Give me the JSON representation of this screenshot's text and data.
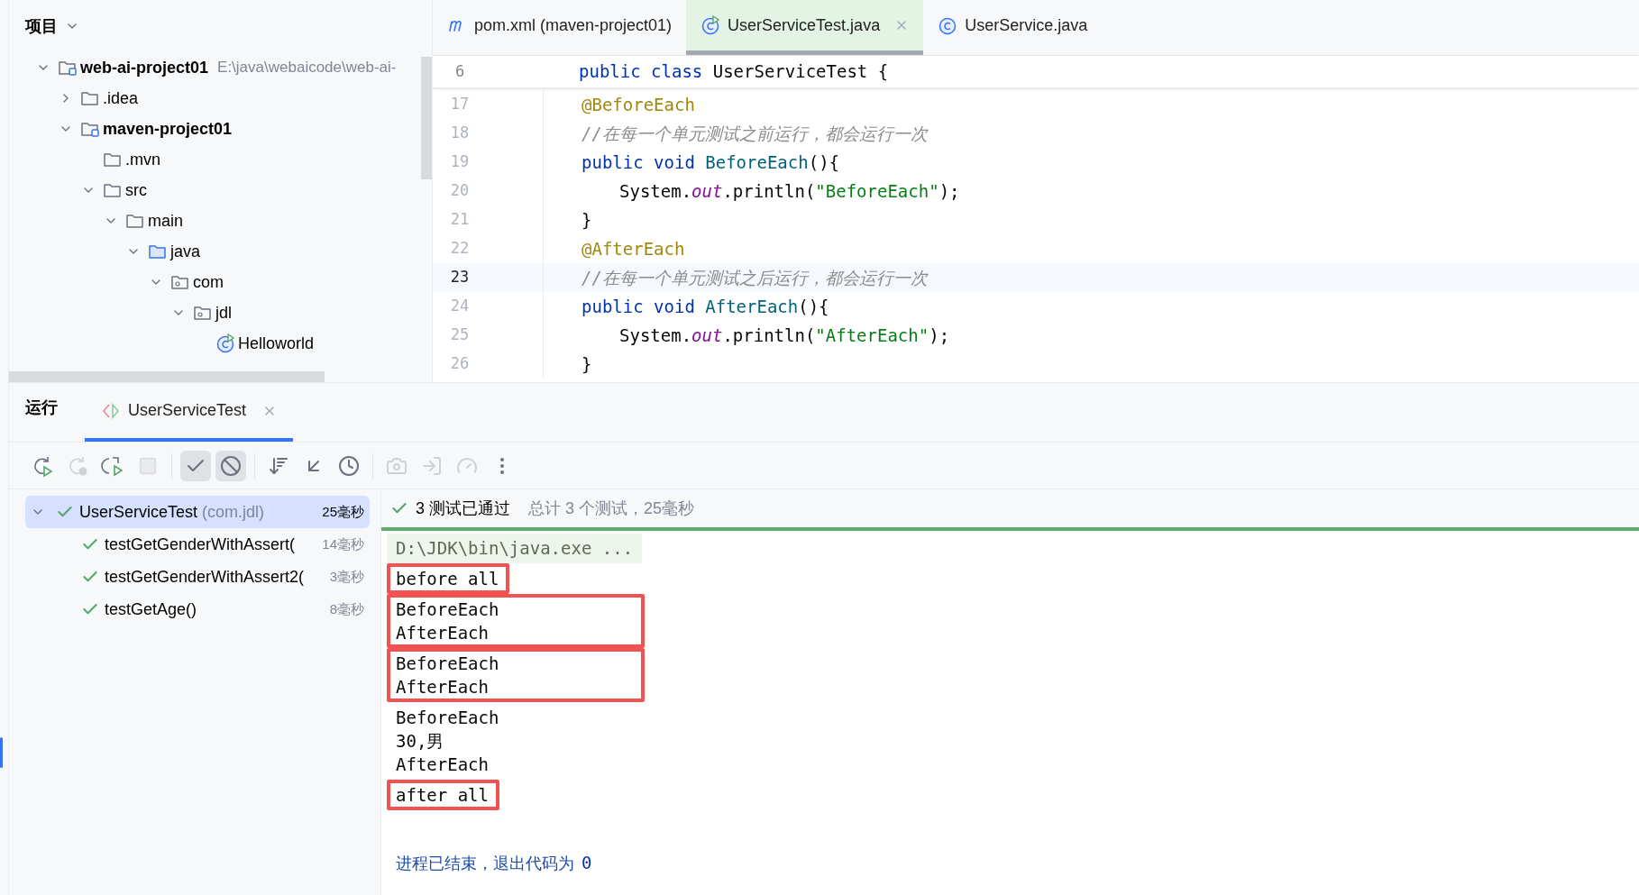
{
  "project_panel": {
    "title": "项目",
    "tree": [
      {
        "kind": "module",
        "label": "web-ai-project01",
        "path": "E:\\java\\webaicode\\web-ai-",
        "expanded": true,
        "children": [
          {
            "kind": "folder",
            "label": ".idea",
            "expanded": false
          },
          {
            "kind": "module",
            "label": "maven-project01",
            "expanded": true,
            "children": [
              {
                "kind": "folder",
                "label": ".mvn"
              },
              {
                "kind": "folder",
                "label": "src",
                "expanded": true,
                "children": [
                  {
                    "kind": "folder",
                    "label": "main",
                    "expanded": true,
                    "children": [
                      {
                        "kind": "source",
                        "label": "java",
                        "expanded": true,
                        "children": [
                          {
                            "kind": "package",
                            "label": "com",
                            "expanded": true,
                            "children": [
                              {
                                "kind": "package",
                                "label": "jdl",
                                "expanded": true,
                                "children": [
                                  {
                                    "kind": "test-class",
                                    "label": "Helloworld"
                                  }
                                ]
                              }
                            ]
                          }
                        ]
                      }
                    ]
                  }
                ]
              }
            ]
          }
        ]
      }
    ]
  },
  "editor": {
    "tabs": [
      {
        "kind": "maven",
        "label": "pom.xml (maven-project01)",
        "selected": false,
        "closable": false
      },
      {
        "kind": "test-class",
        "label": "UserServiceTest.java",
        "selected": true,
        "closable": true
      },
      {
        "kind": "class",
        "label": "UserService.java",
        "selected": false,
        "closable": false
      }
    ],
    "sticky_line": {
      "number": "6",
      "kind": "class",
      "tokens": [
        {
          "kind": "keyword",
          "text": "public class"
        },
        {
          "kind": "plain",
          "text": " UserServiceTest {"
        }
      ]
    },
    "lines": [
      {
        "number": "17",
        "kind": "member",
        "current": false,
        "tokens": [
          {
            "kind": "annotation",
            "text": "@BeforeEach"
          }
        ]
      },
      {
        "number": "18",
        "kind": "member",
        "current": false,
        "tokens": [
          {
            "kind": "comment",
            "text": "//在每一个单元测试之前运行，都会运行一次"
          }
        ]
      },
      {
        "number": "19",
        "kind": "member",
        "current": false,
        "tokens": [
          {
            "kind": "keyword",
            "text": "public void"
          },
          {
            "kind": "method",
            "text": " BeforeEach"
          },
          {
            "kind": "plain",
            "text": "(){"
          }
        ]
      },
      {
        "number": "20",
        "kind": "body",
        "current": false,
        "tokens": [
          {
            "kind": "plain",
            "text": "System."
          },
          {
            "kind": "field",
            "text": "out"
          },
          {
            "kind": "plain",
            "text": ".println("
          },
          {
            "kind": "string",
            "text": "\"BeforeEach\""
          },
          {
            "kind": "plain",
            "text": ");"
          }
        ]
      },
      {
        "number": "21",
        "kind": "member",
        "current": false,
        "tokens": [
          {
            "kind": "plain",
            "text": "}"
          }
        ]
      },
      {
        "number": "22",
        "kind": "member",
        "current": false,
        "tokens": [
          {
            "kind": "annotation",
            "text": "@AfterEach"
          }
        ]
      },
      {
        "number": "23",
        "kind": "member",
        "current": true,
        "tokens": [
          {
            "kind": "comment",
            "text": "//在每一个单元测试之后运行，都会运行一次"
          }
        ]
      },
      {
        "number": "24",
        "kind": "member",
        "current": false,
        "tokens": [
          {
            "kind": "keyword",
            "text": "public void"
          },
          {
            "kind": "method",
            "text": " AfterEach"
          },
          {
            "kind": "plain",
            "text": "(){"
          }
        ]
      },
      {
        "number": "25",
        "kind": "body",
        "current": false,
        "tokens": [
          {
            "kind": "plain",
            "text": "System."
          },
          {
            "kind": "field",
            "text": "out"
          },
          {
            "kind": "plain",
            "text": ".println("
          },
          {
            "kind": "string",
            "text": "\"AfterEach\""
          },
          {
            "kind": "plain",
            "text": ");"
          }
        ]
      },
      {
        "number": "26",
        "kind": "member",
        "current": false,
        "tokens": [
          {
            "kind": "plain",
            "text": "}"
          }
        ]
      }
    ]
  },
  "run_panel": {
    "title": "运行",
    "tab": {
      "label": "UserServiceTest",
      "selected": true
    },
    "toolbar": [
      {
        "kind": "rerun",
        "disabled": false,
        "on": false
      },
      {
        "kind": "rerun-failed",
        "disabled": true,
        "on": false
      },
      {
        "kind": "toggle-auto",
        "disabled": false,
        "on": false
      },
      {
        "kind": "stop",
        "disabled": true,
        "on": false
      },
      {
        "kind": "show-passed",
        "disabled": false,
        "on": true
      },
      {
        "kind": "show-ignored",
        "disabled": false,
        "on": true
      },
      {
        "kind": "sort",
        "disabled": false,
        "on": false
      },
      {
        "kind": "collapse",
        "disabled": false,
        "on": false
      },
      {
        "kind": "history",
        "disabled": false,
        "on": false
      },
      {
        "kind": "screenshot",
        "disabled": true,
        "on": false
      },
      {
        "kind": "export",
        "disabled": true,
        "on": false
      },
      {
        "kind": "coverage",
        "disabled": true,
        "on": false
      },
      {
        "kind": "more",
        "disabled": false,
        "on": false
      }
    ],
    "tests": {
      "label": "UserServiceTest",
      "package": "(com.jdl)",
      "duration": "25毫秒",
      "kind": "passed",
      "expanded": true,
      "selected": true,
      "children": [
        {
          "label": "testGetGenderWithAssert(",
          "duration": "14毫秒",
          "kind": "passed",
          "selected": false
        },
        {
          "label": "testGetGenderWithAssert2(",
          "duration": "3毫秒",
          "kind": "passed",
          "selected": false
        },
        {
          "label": "testGetAge()",
          "duration": "8毫秒",
          "kind": "passed",
          "selected": false
        }
      ]
    },
    "summary": {
      "kind": "passed",
      "result": "3 测试已通过",
      "details": "总计 3 个测试，25毫秒"
    },
    "console": {
      "command": "D:\\JDK\\bin\\java.exe ...",
      "blocks": [
        {
          "boxed": true,
          "lines": [
            "before all"
          ]
        },
        {
          "boxed": true,
          "lines": [
            "BeforeEach",
            "AfterEach"
          ]
        },
        {
          "boxed": true,
          "lines": [
            "BeforeEach",
            "AfterEach"
          ]
        },
        {
          "boxed": false,
          "lines": [
            "BeforeEach",
            "30,男",
            "AfterEach"
          ]
        },
        {
          "boxed": true,
          "lines": [
            "after all"
          ]
        }
      ],
      "exit_message": "进程已结束，退出代码为",
      "exit_code": "0"
    }
  }
}
